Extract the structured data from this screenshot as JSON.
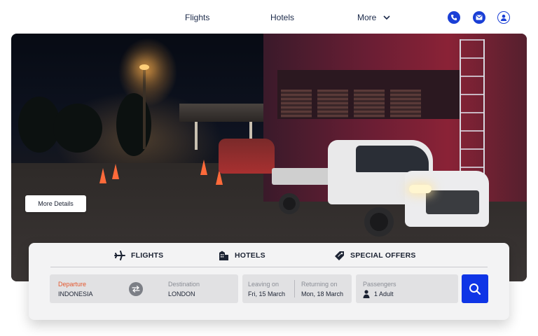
{
  "nav": {
    "links": [
      "Flights",
      "Hotels",
      "More"
    ],
    "icons": [
      "phone-icon",
      "mail-icon",
      "user-icon"
    ],
    "accent": "#1a3fd6"
  },
  "hero": {
    "details_label": "More Details"
  },
  "booking": {
    "tabs": [
      {
        "label": "FLIGHTS",
        "icon": "plane-icon"
      },
      {
        "label": "HOTELS",
        "icon": "hotel-icon"
      },
      {
        "label": "SPECIAL OFFERS",
        "icon": "tag-icon"
      }
    ],
    "departure": {
      "label": "Departure",
      "value": "INDONESIA",
      "label_color": "#e4572e"
    },
    "destination": {
      "label": "Destination",
      "value": "LONDON"
    },
    "leaving": {
      "label": "Leaving on",
      "value": "Fri, 15 March"
    },
    "returning": {
      "label": "Returning on",
      "value": "Mon, 18 March"
    },
    "passengers": {
      "label": "Passengers",
      "value": "1 Adult"
    },
    "search_color": "#0f35e6"
  }
}
